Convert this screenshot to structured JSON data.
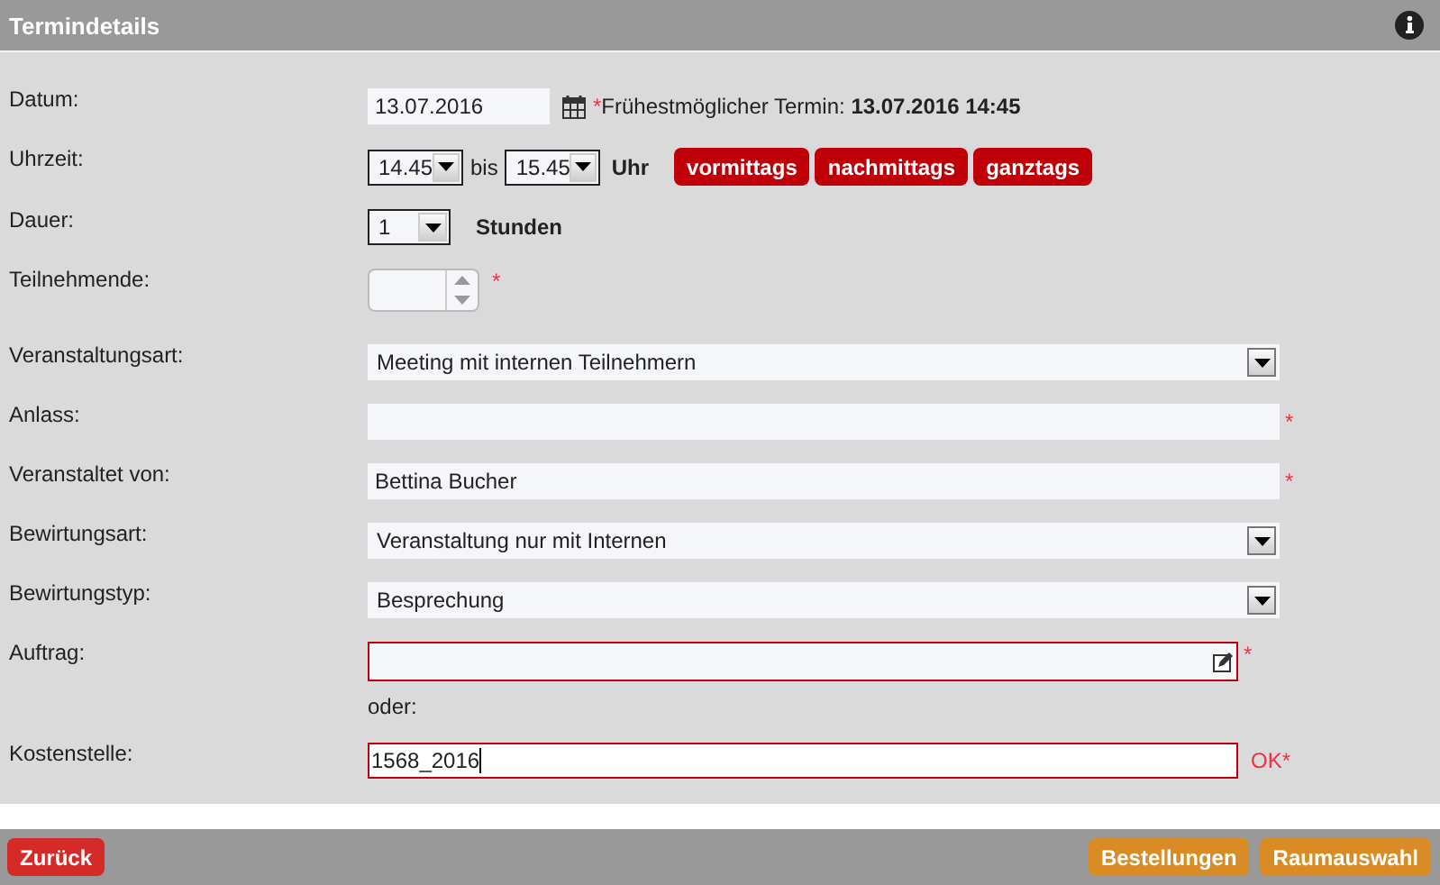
{
  "header": {
    "title": "Termindetails"
  },
  "rows": [
    {
      "kind": "date",
      "label": "Datum:",
      "value": "13.07.2016",
      "marker": "*",
      "note_label": "Frühestmöglicher Termin:",
      "note_value": "13.07.2016 14:45"
    },
    {
      "kind": "time",
      "label": "Uhrzeit:",
      "from": "14.45",
      "separator": "bis",
      "to": "15.45",
      "unit": "Uhr",
      "buttons": [
        "vormittags",
        "nachmittags",
        "ganztags"
      ]
    },
    {
      "kind": "duration",
      "label": "Dauer:",
      "value": "1",
      "unit": "Stunden"
    },
    {
      "kind": "number",
      "label": "Teilnehmende:",
      "marker": "*"
    },
    {
      "kind": "select",
      "label": "Veranstaltungsart:",
      "value": "Meeting mit internen Teilnehmern"
    },
    {
      "kind": "text",
      "label": "Anlass:",
      "marker": "*",
      "invalid": false
    },
    {
      "kind": "text",
      "label": "Veranstaltet von:",
      "value": "Bettina Bucher",
      "marker": "*",
      "invalid": false
    },
    {
      "kind": "select",
      "label": "Bewirtungsart:",
      "value": "Veranstaltung nur mit Internen"
    },
    {
      "kind": "select",
      "label": "Bewirtungstyp:",
      "value": "Besprechung"
    },
    {
      "kind": "picker",
      "label": "Auftrag:",
      "marker": "*",
      "invalid": true,
      "hint": "oder:"
    },
    {
      "kind": "text",
      "label": "Kostenstelle:",
      "value": "1568_2016",
      "marker": "OK*",
      "invalid": true,
      "focused": true
    }
  ],
  "footer": {
    "back": "Zurück",
    "actions": [
      "Bestellungen",
      "Raumauswahl"
    ]
  }
}
